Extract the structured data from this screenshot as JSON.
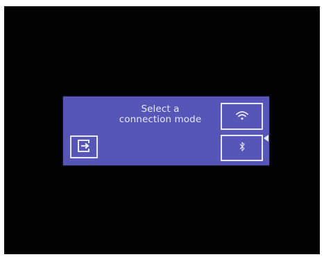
{
  "screen": {
    "prompt_line1": "Select a",
    "prompt_line2": "connection mode"
  },
  "buttons": {
    "exit_icon": "exit-arrow-icon",
    "wifi_icon": "wifi-icon",
    "bluetooth_icon": "bluetooth-icon"
  },
  "colors": {
    "panel": "#5656b8",
    "outline": "#e9e9f5",
    "background": "#020203"
  }
}
